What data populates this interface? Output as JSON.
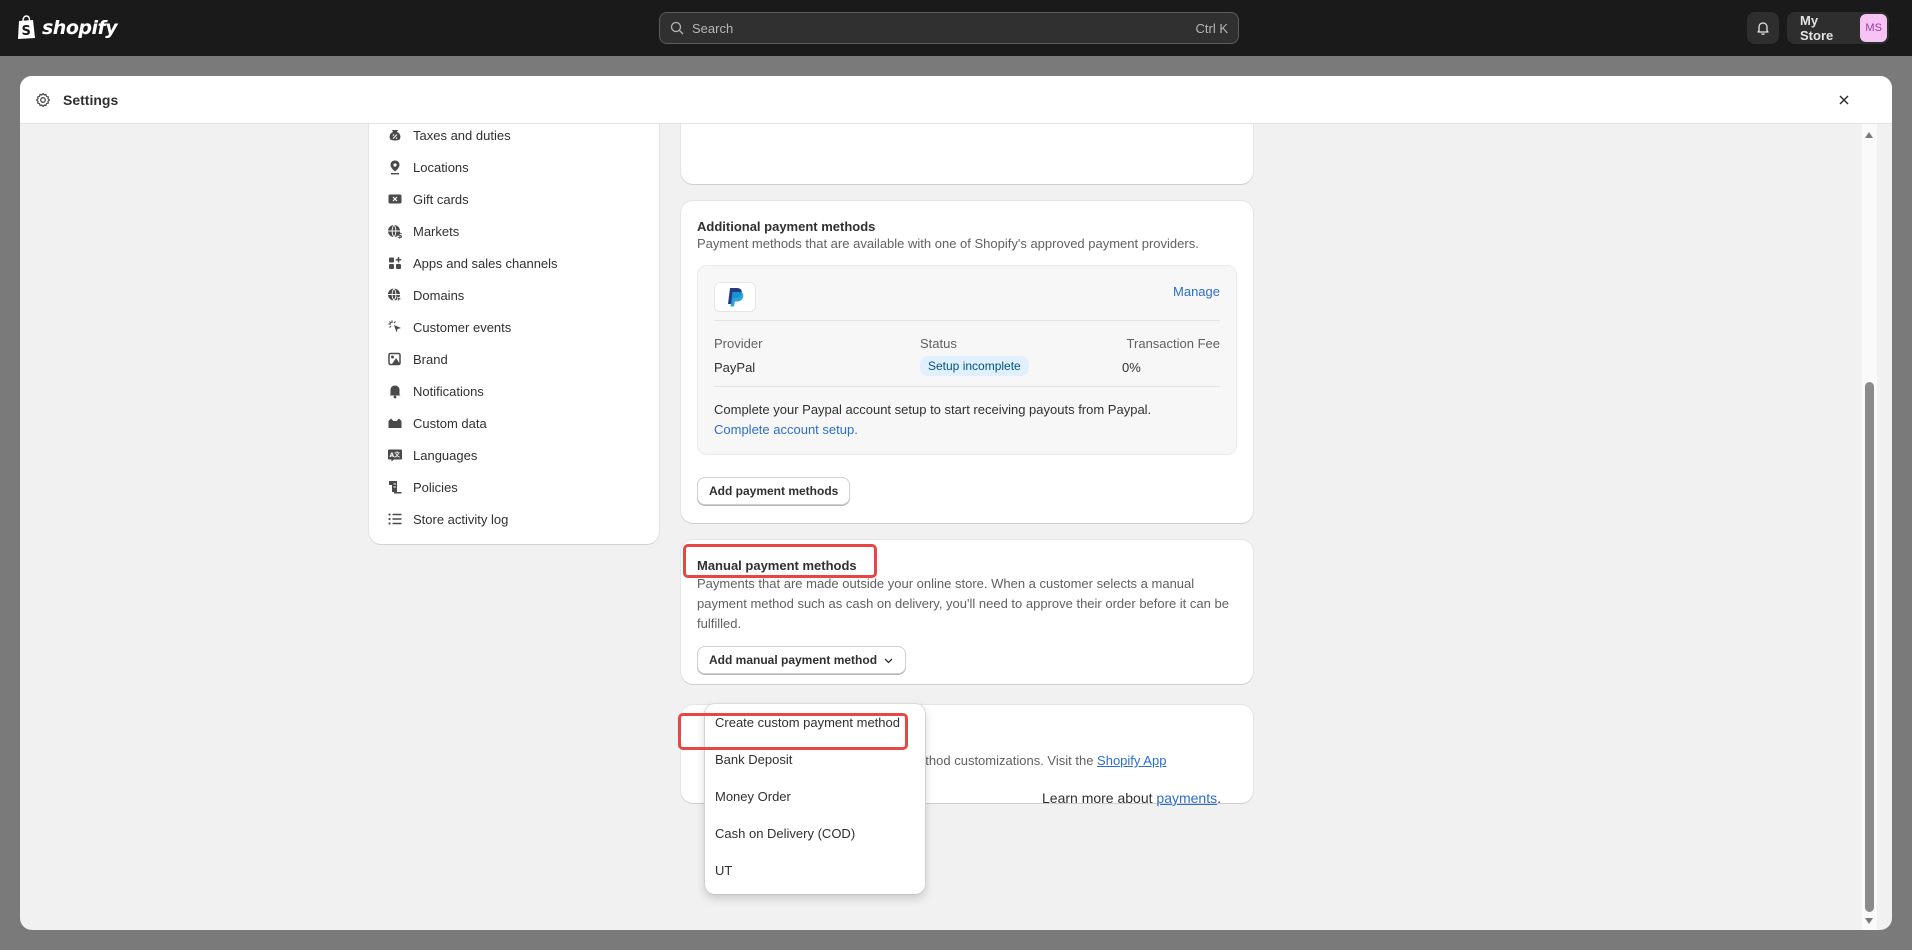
{
  "topbar": {
    "brand": "shopify",
    "search": {
      "placeholder": "Search",
      "shortcut": "Ctrl K"
    },
    "store_name": "My Store",
    "avatar_initials": "MS"
  },
  "modal": {
    "title": "Settings",
    "close_icon": "close-icon"
  },
  "sidebar": {
    "items": [
      {
        "label": "Taxes and duties",
        "icon": "taxes-icon"
      },
      {
        "label": "Locations",
        "icon": "location-pin-icon"
      },
      {
        "label": "Gift cards",
        "icon": "gift-card-icon"
      },
      {
        "label": "Markets",
        "icon": "globe-dollar-icon"
      },
      {
        "label": "Apps and sales channels",
        "icon": "apps-icon"
      },
      {
        "label": "Domains",
        "icon": "globe-cursor-icon"
      },
      {
        "label": "Customer events",
        "icon": "cursor-click-icon"
      },
      {
        "label": "Brand",
        "icon": "brand-icon"
      },
      {
        "label": "Notifications",
        "icon": "bell-icon"
      },
      {
        "label": "Custom data",
        "icon": "custom-data-icon"
      },
      {
        "label": "Languages",
        "icon": "language-icon"
      },
      {
        "label": "Policies",
        "icon": "policy-icon"
      },
      {
        "label": "Store activity log",
        "icon": "list-icon"
      }
    ]
  },
  "additional_payments": {
    "title": "Additional payment methods",
    "description": "Payment methods that are available with one of Shopify's approved payment providers.",
    "provider_logo": "paypal-logo",
    "manage_label": "Manage",
    "columns": [
      "Provider",
      "Status",
      "Transaction Fee"
    ],
    "row": {
      "provider": "PayPal",
      "status": "Setup incomplete",
      "fee": "0%"
    },
    "setup_text": "Complete your Paypal account setup to start receiving payouts from Paypal.",
    "setup_link": "Complete account setup.",
    "add_button": "Add payment methods"
  },
  "manual_payments": {
    "title": "Manual payment methods",
    "description": "Payments that are made outside your online store. When a customer selects a manual payment method such as cash on delivery, you'll need to approve their order before it can be fulfilled.",
    "add_button": "Add manual payment method",
    "dropdown_options": [
      "Create custom payment method",
      "Bank Deposit",
      "Money Order",
      "Cash on Delivery (COD)",
      "UT"
    ]
  },
  "customizations": {
    "text_visible": "ayment method customizations. Visit the ",
    "link": "Shopify App"
  },
  "footer": {
    "learn_more_prefix": "Learn more about ",
    "learn_more_link": "payments",
    "learn_more_suffix": "."
  },
  "colors": {
    "topbar_bg": "#1a1a1a",
    "link": "#2c6ecb",
    "highlight": "#e84545",
    "badge_bg": "#e0f0ff",
    "avatar_bg": "#f5c4f5"
  }
}
